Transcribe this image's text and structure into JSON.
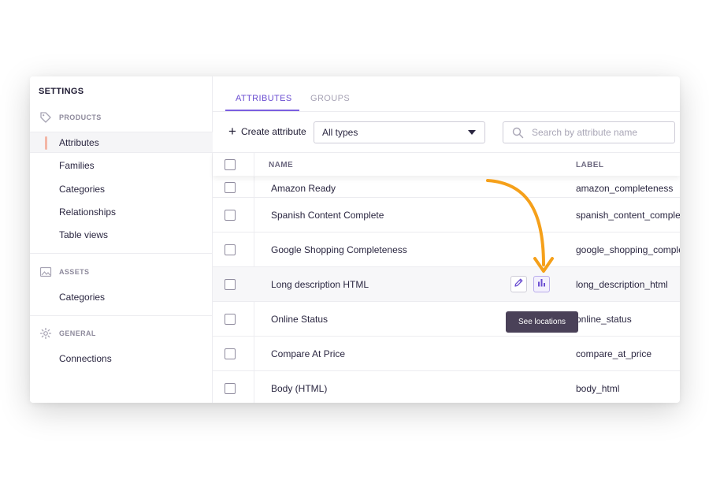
{
  "sidebar": {
    "title": "SETTINGS",
    "sections": [
      {
        "label": "PRODUCTS",
        "icon": "tag-icon"
      },
      {
        "label": "ASSETS",
        "icon": "image-icon"
      },
      {
        "label": "GENERAL",
        "icon": "gear-icon"
      }
    ],
    "items": [
      {
        "label": "Attributes",
        "active": true
      },
      {
        "label": "Families"
      },
      {
        "label": "Categories"
      },
      {
        "label": "Relationships"
      },
      {
        "label": "Table views"
      },
      {
        "label": "Categories"
      },
      {
        "label": "Connections"
      }
    ]
  },
  "tabs": [
    {
      "label": "ATTRIBUTES",
      "active": true
    },
    {
      "label": "GROUPS",
      "active": false
    }
  ],
  "toolbar": {
    "create_label": "Create attribute",
    "type_filter": "All types",
    "search_placeholder": "Search by attribute name"
  },
  "table": {
    "columns": [
      "NAME",
      "LABEL"
    ],
    "rows": [
      {
        "name": "Amazon Ready",
        "label": "amazon_completeness"
      },
      {
        "name": "Spanish Content Complete",
        "label": "spanish_content_complet"
      },
      {
        "name": "Google Shopping Completeness",
        "label": "google_shopping_comple"
      },
      {
        "name": "Long description HTML",
        "label": "long_description_html"
      },
      {
        "name": "Online Status",
        "label": "online_status"
      },
      {
        "name": "Compare At Price",
        "label": "compare_at_price"
      },
      {
        "name": "Body (HTML)",
        "label": "body_html"
      }
    ]
  },
  "tooltip": "See locations",
  "colors": {
    "accent": "#6a4dd1",
    "annotation_arrow": "#f5a01a",
    "tooltip_bg": "#4a4158"
  }
}
